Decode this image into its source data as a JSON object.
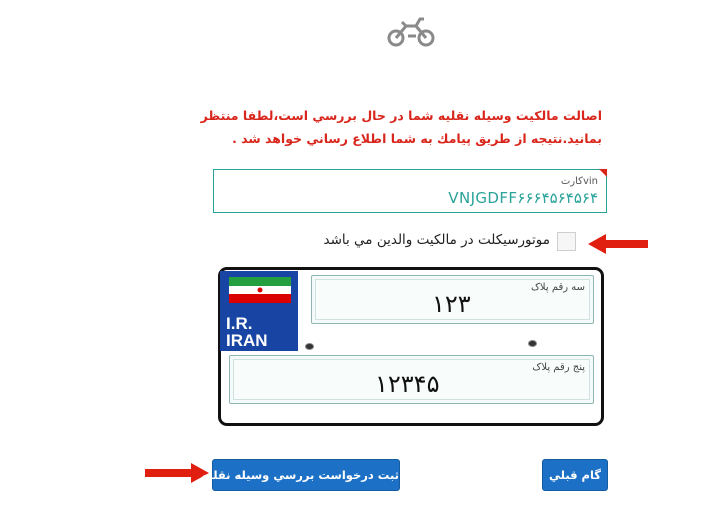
{
  "notice": {
    "line1": "اصالت مالكيت وسيله نقليه شما در حال بررسي است،لطفا منتظر",
    "line2": "بمانيد.نتيجه از طريق پيامك به شما اطلاع رساني خواهد شد ."
  },
  "vin": {
    "label": "vinکارت",
    "value": "VNJGDFF۶۶۶۴۵۶۴۵۶۴"
  },
  "parents_ownership": {
    "label": "موتورسيكلت در مالكيت والدين مي باشد",
    "checked": false
  },
  "plate": {
    "country_line1": "I.R.",
    "country_line2": "IRAN",
    "three_digit_label": "سه رقم پلاک",
    "three_digit_value": "۱۲۳",
    "five_digit_label": "پنج رقم پلاک",
    "five_digit_value": "۱۲۳۴۵"
  },
  "buttons": {
    "submit": "ثبت درخواست بررسي وسيله نقليه",
    "previous": "گام قبلي"
  },
  "colors": {
    "accent": "#1c71c6",
    "notice": "#d9261c",
    "vin_value": "#2aa39a",
    "arrow": "#e01f10",
    "plate_blue": "#1844a3"
  },
  "icons": [
    "motorcycle-icon",
    "arrow-right-icon",
    "arrow-left-icon",
    "iran-flag-icon"
  ]
}
